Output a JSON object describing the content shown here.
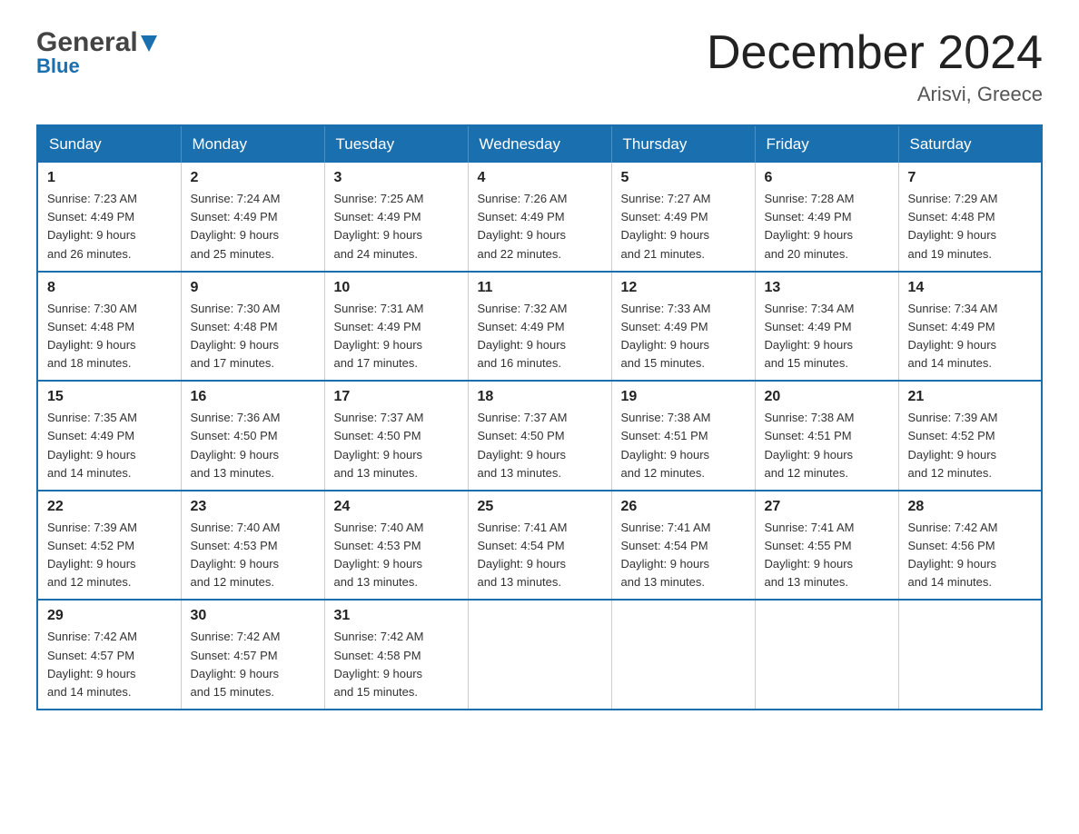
{
  "header": {
    "logo_general": "General",
    "logo_blue": "Blue",
    "main_title": "December 2024",
    "subtitle": "Arisvi, Greece"
  },
  "calendar": {
    "headers": [
      "Sunday",
      "Monday",
      "Tuesday",
      "Wednesday",
      "Thursday",
      "Friday",
      "Saturday"
    ],
    "weeks": [
      [
        {
          "day": "1",
          "sunrise": "7:23 AM",
          "sunset": "4:49 PM",
          "daylight": "9 hours and 26 minutes."
        },
        {
          "day": "2",
          "sunrise": "7:24 AM",
          "sunset": "4:49 PM",
          "daylight": "9 hours and 25 minutes."
        },
        {
          "day": "3",
          "sunrise": "7:25 AM",
          "sunset": "4:49 PM",
          "daylight": "9 hours and 24 minutes."
        },
        {
          "day": "4",
          "sunrise": "7:26 AM",
          "sunset": "4:49 PM",
          "daylight": "9 hours and 22 minutes."
        },
        {
          "day": "5",
          "sunrise": "7:27 AM",
          "sunset": "4:49 PM",
          "daylight": "9 hours and 21 minutes."
        },
        {
          "day": "6",
          "sunrise": "7:28 AM",
          "sunset": "4:49 PM",
          "daylight": "9 hours and 20 minutes."
        },
        {
          "day": "7",
          "sunrise": "7:29 AM",
          "sunset": "4:48 PM",
          "daylight": "9 hours and 19 minutes."
        }
      ],
      [
        {
          "day": "8",
          "sunrise": "7:30 AM",
          "sunset": "4:48 PM",
          "daylight": "9 hours and 18 minutes."
        },
        {
          "day": "9",
          "sunrise": "7:30 AM",
          "sunset": "4:48 PM",
          "daylight": "9 hours and 17 minutes."
        },
        {
          "day": "10",
          "sunrise": "7:31 AM",
          "sunset": "4:49 PM",
          "daylight": "9 hours and 17 minutes."
        },
        {
          "day": "11",
          "sunrise": "7:32 AM",
          "sunset": "4:49 PM",
          "daylight": "9 hours and 16 minutes."
        },
        {
          "day": "12",
          "sunrise": "7:33 AM",
          "sunset": "4:49 PM",
          "daylight": "9 hours and 15 minutes."
        },
        {
          "day": "13",
          "sunrise": "7:34 AM",
          "sunset": "4:49 PM",
          "daylight": "9 hours and 15 minutes."
        },
        {
          "day": "14",
          "sunrise": "7:34 AM",
          "sunset": "4:49 PM",
          "daylight": "9 hours and 14 minutes."
        }
      ],
      [
        {
          "day": "15",
          "sunrise": "7:35 AM",
          "sunset": "4:49 PM",
          "daylight": "9 hours and 14 minutes."
        },
        {
          "day": "16",
          "sunrise": "7:36 AM",
          "sunset": "4:50 PM",
          "daylight": "9 hours and 13 minutes."
        },
        {
          "day": "17",
          "sunrise": "7:37 AM",
          "sunset": "4:50 PM",
          "daylight": "9 hours and 13 minutes."
        },
        {
          "day": "18",
          "sunrise": "7:37 AM",
          "sunset": "4:50 PM",
          "daylight": "9 hours and 13 minutes."
        },
        {
          "day": "19",
          "sunrise": "7:38 AM",
          "sunset": "4:51 PM",
          "daylight": "9 hours and 12 minutes."
        },
        {
          "day": "20",
          "sunrise": "7:38 AM",
          "sunset": "4:51 PM",
          "daylight": "9 hours and 12 minutes."
        },
        {
          "day": "21",
          "sunrise": "7:39 AM",
          "sunset": "4:52 PM",
          "daylight": "9 hours and 12 minutes."
        }
      ],
      [
        {
          "day": "22",
          "sunrise": "7:39 AM",
          "sunset": "4:52 PM",
          "daylight": "9 hours and 12 minutes."
        },
        {
          "day": "23",
          "sunrise": "7:40 AM",
          "sunset": "4:53 PM",
          "daylight": "9 hours and 12 minutes."
        },
        {
          "day": "24",
          "sunrise": "7:40 AM",
          "sunset": "4:53 PM",
          "daylight": "9 hours and 13 minutes."
        },
        {
          "day": "25",
          "sunrise": "7:41 AM",
          "sunset": "4:54 PM",
          "daylight": "9 hours and 13 minutes."
        },
        {
          "day": "26",
          "sunrise": "7:41 AM",
          "sunset": "4:54 PM",
          "daylight": "9 hours and 13 minutes."
        },
        {
          "day": "27",
          "sunrise": "7:41 AM",
          "sunset": "4:55 PM",
          "daylight": "9 hours and 13 minutes."
        },
        {
          "day": "28",
          "sunrise": "7:42 AM",
          "sunset": "4:56 PM",
          "daylight": "9 hours and 14 minutes."
        }
      ],
      [
        {
          "day": "29",
          "sunrise": "7:42 AM",
          "sunset": "4:57 PM",
          "daylight": "9 hours and 14 minutes."
        },
        {
          "day": "30",
          "sunrise": "7:42 AM",
          "sunset": "4:57 PM",
          "daylight": "9 hours and 15 minutes."
        },
        {
          "day": "31",
          "sunrise": "7:42 AM",
          "sunset": "4:58 PM",
          "daylight": "9 hours and 15 minutes."
        },
        null,
        null,
        null,
        null
      ]
    ]
  },
  "labels": {
    "sunrise_label": "Sunrise: ",
    "sunset_label": "Sunset: ",
    "daylight_label": "Daylight: "
  }
}
